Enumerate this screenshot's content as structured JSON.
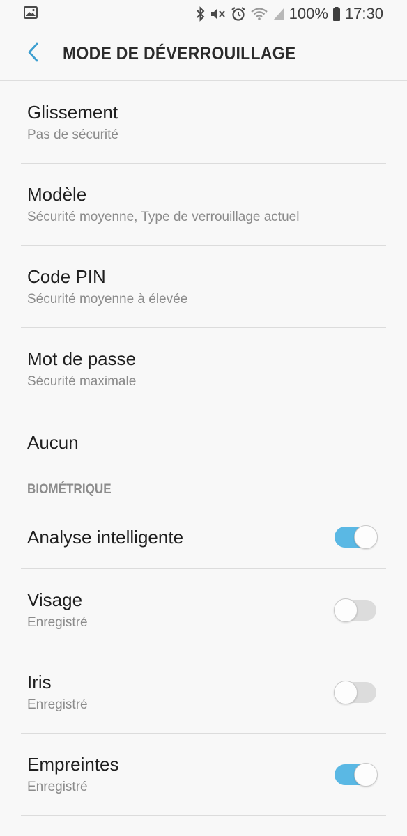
{
  "status": {
    "battery": "100%",
    "time": "17:30",
    "icons": [
      "gallery-icon",
      "bluetooth-icon",
      "mute-icon",
      "alarm-icon",
      "wifi-icon",
      "signal-icon",
      "battery-icon"
    ]
  },
  "header": {
    "title": "MODE DE DÉVERROUILLAGE",
    "back_icon": "back-arrow-icon"
  },
  "lock_types": [
    {
      "title": "Glissement",
      "subtitle": "Pas de sécurité"
    },
    {
      "title": "Modèle",
      "subtitle": "Sécurité moyenne, Type de verrouillage actuel"
    },
    {
      "title": "Code PIN",
      "subtitle": "Sécurité moyenne à élevée"
    },
    {
      "title": "Mot de passe",
      "subtitle": "Sécurité maximale"
    },
    {
      "title": "Aucun"
    }
  ],
  "biometric": {
    "header": "BIOMÉTRIQUE",
    "items": [
      {
        "title": "Analyse intelligente",
        "enabled": true
      },
      {
        "title": "Visage",
        "subtitle": "Enregistré",
        "enabled": false
      },
      {
        "title": "Iris",
        "subtitle": "Enregistré",
        "enabled": false
      },
      {
        "title": "Empreintes",
        "subtitle": "Enregistré",
        "enabled": true
      }
    ]
  },
  "colors": {
    "accent": "#5ab8e4",
    "background": "#f8f8f8",
    "back_arrow": "#3d9fd1"
  }
}
